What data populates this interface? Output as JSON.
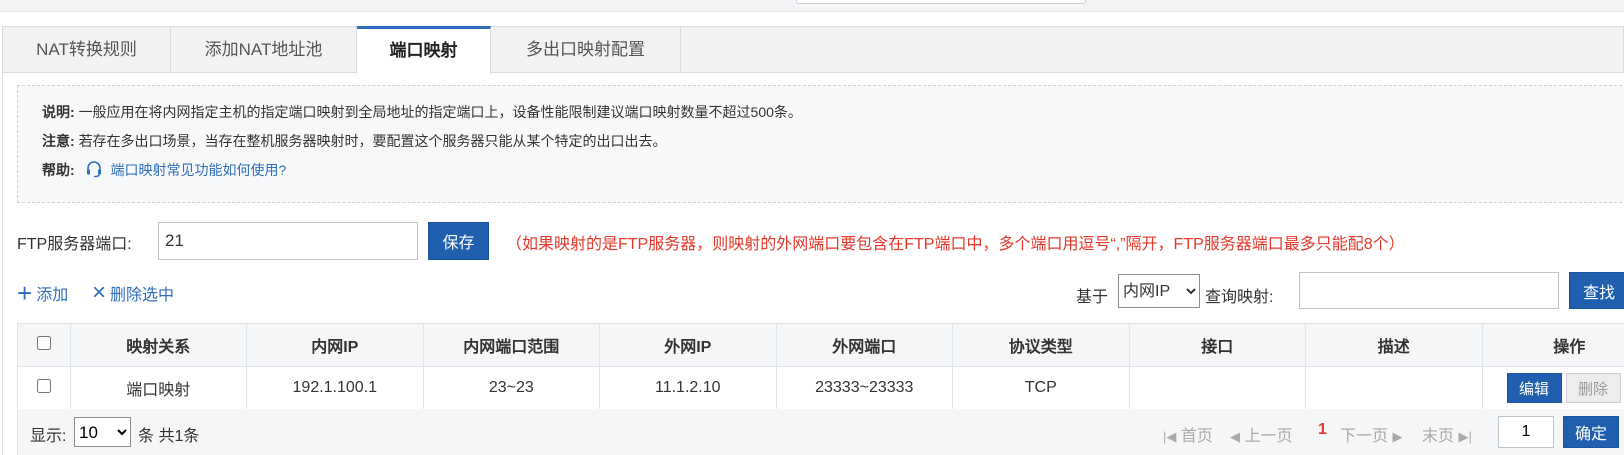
{
  "tabs": [
    {
      "label": "NAT转换规则"
    },
    {
      "label": "添加NAT地址池"
    },
    {
      "label": "端口映射"
    },
    {
      "label": "多出口映射配置"
    }
  ],
  "info": {
    "desc_key": "说明:",
    "desc_text": "一般应用在将内网指定主机的指定端口映射到全局地址的指定端口上，设备性能限制建议端口映射数量不超过500条。",
    "note_key": "注意:",
    "note_text": "若存在多出口场景，当存在整机服务器映射时，要配置这个服务器只能从某个特定的出口出去。",
    "help_key": "帮助:",
    "help_link": "端口映射常见功能如何使用?"
  },
  "ftp": {
    "label": "FTP服务器端口:",
    "value": "21",
    "save_label": "保存",
    "note": "（如果映射的是FTP服务器，则映射的外网端口要包含在FTP端口中，多个端口用逗号“,”隔开，FTP服务器端口最多只能配8个）"
  },
  "toolbar": {
    "add_label": "添加",
    "delete_selected_label": "删除选中",
    "based_label": "基于",
    "based_value": "内网IP",
    "query_label": "查询映射:",
    "query_value": "",
    "search_label": "查找"
  },
  "table": {
    "headers": [
      "映射关系",
      "内网IP",
      "内网端口范围",
      "外网IP",
      "外网端口",
      "协议类型",
      "接口",
      "描述",
      "操作"
    ],
    "rows": [
      {
        "relation": "端口映射",
        "inner_ip": "192.1.100.1",
        "inner_port": "23~23",
        "outer_ip": "11.1.2.10",
        "outer_port": "23333~23333",
        "protocol": "TCP",
        "interface": "",
        "desc": "",
        "edit": "编辑",
        "delete": "删除"
      }
    ]
  },
  "footer": {
    "show_label": "显示:",
    "page_size": "10",
    "total": "条 共1条",
    "first": "首页",
    "prev": "上一页",
    "current": "1",
    "next": "下一页",
    "last": "末页",
    "jump_value": "1",
    "ok_label": "确定"
  },
  "colors": {
    "accent": "#1f5fad",
    "link": "#2f6ebd",
    "warning": "#e5372a"
  }
}
